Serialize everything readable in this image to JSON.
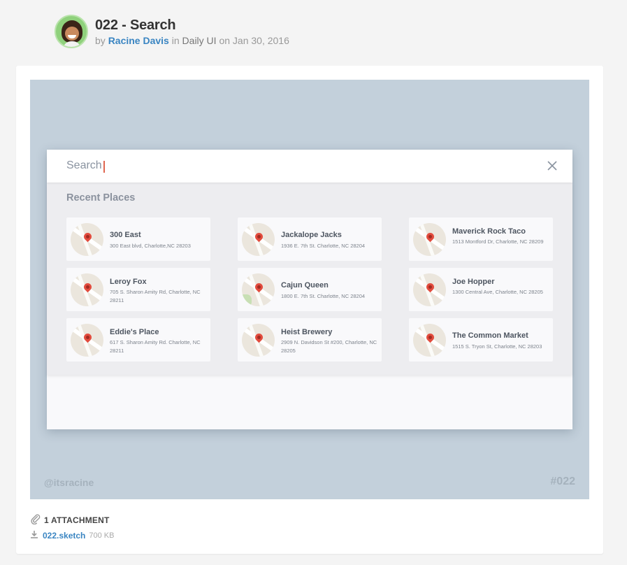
{
  "shot": {
    "title": "022 - Search",
    "by_label": "by",
    "author": "Racine Davis",
    "in_label": "in",
    "team": "Daily UI",
    "on_label": "on",
    "date": "Jan 30, 2016"
  },
  "search": {
    "value": "Search",
    "close_icon": "close-icon"
  },
  "recent": {
    "heading": "Recent Places",
    "places": [
      {
        "name": "300 East",
        "address": "300 East blvd, Charlotte,NC 28203"
      },
      {
        "name": "Jackalope Jacks",
        "address": "1936 E. 7th St. Charlotte, NC 28204"
      },
      {
        "name": "Maverick Rock Taco",
        "address": "1513 Montford Dr, Charlotte, NC 28209"
      },
      {
        "name": "Leroy Fox",
        "address": "705 S. Sharon Amity Rd, Charlotte, NC 28211"
      },
      {
        "name": "Cajun Queen",
        "address": "1800 E. 7th St. Charlotte, NC 28204"
      },
      {
        "name": "Joe Hopper",
        "address": "1300 Central Ave, Charlotte, NC 28205"
      },
      {
        "name": "Eddie's Place",
        "address": "617 S. Sharon Amity Rd. Charlotte, NC 28211"
      },
      {
        "name": "Heist Brewery",
        "address": "2909 N. Davidson St #200, Charlotte, NC 28205"
      },
      {
        "name": "The Common Market",
        "address": "1515 S. Tryon St, Charlotte, NC 28203"
      }
    ]
  },
  "footer": {
    "handle": "@itsracine",
    "tag": "#022"
  },
  "attachments": {
    "count_label": "1 ATTACHMENT",
    "file_name": "022.sketch",
    "file_size": "700 KB"
  },
  "colors": {
    "shot_background": "#c3d0db",
    "link": "#3a85c2",
    "caret": "#e0654f",
    "pin": "#e24b3d"
  }
}
